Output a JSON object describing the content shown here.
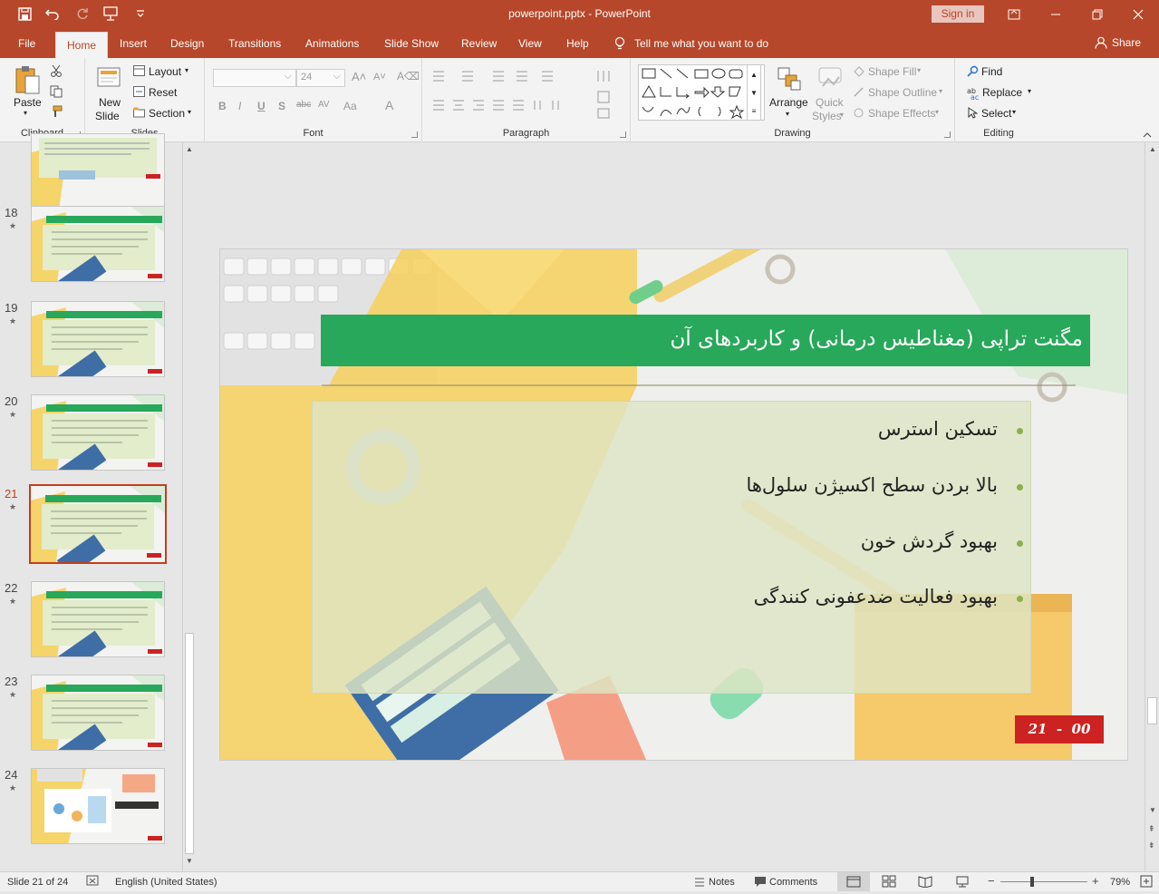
{
  "window": {
    "title": "powerpoint.pptx  -  PowerPoint",
    "sign_in": "Sign in"
  },
  "tabs": [
    {
      "label": "File"
    },
    {
      "label": "Home"
    },
    {
      "label": "Insert"
    },
    {
      "label": "Design"
    },
    {
      "label": "Transitions"
    },
    {
      "label": "Animations"
    },
    {
      "label": "Slide Show"
    },
    {
      "label": "Review"
    },
    {
      "label": "View"
    },
    {
      "label": "Help"
    }
  ],
  "tell_me": "Tell me what you want to do",
  "share": "Share",
  "ribbon": {
    "clipboard": {
      "label": "Clipboard",
      "paste": "Paste"
    },
    "slides": {
      "label": "Slides",
      "new_slide_1": "New",
      "new_slide_2": "Slide",
      "layout": "Layout",
      "reset": "Reset",
      "section": "Section"
    },
    "font": {
      "label": "Font",
      "size": "24"
    },
    "paragraph": {
      "label": "Paragraph"
    },
    "drawing": {
      "label": "Drawing",
      "arrange": "Arrange",
      "quick_styles_1": "Quick",
      "quick_styles_2": "Styles",
      "shape_fill": "Shape Fill",
      "shape_outline": "Shape Outline",
      "shape_effects": "Shape Effects"
    },
    "editing": {
      "label": "Editing",
      "find": "Find",
      "replace": "Replace",
      "select": "Select"
    }
  },
  "thumbnails": [
    {
      "num": "18"
    },
    {
      "num": "19"
    },
    {
      "num": "20"
    },
    {
      "num": "21",
      "selected": true
    },
    {
      "num": "22"
    },
    {
      "num": "23"
    },
    {
      "num": "24"
    }
  ],
  "slide": {
    "title": "مگنت تراپی (مغناطیس درمانی) و کاربردهای آن",
    "bullets": [
      "تسکین استرس",
      "بالا بردن سطح اکسیژن سلول‌ها",
      "بهبود گردش خون",
      "بهبود فعالیت ضدعفونی کنندگی"
    ],
    "page_badge": "21  -  00"
  },
  "status": {
    "slide_info": "Slide 21 of 24",
    "language": "English (United States)",
    "notes": "Notes",
    "comments": "Comments",
    "zoom": "79%"
  },
  "colors": {
    "accent": "#b7472a",
    "title_bar": "#27a85a",
    "badge": "#cc2222",
    "bullet": "#8ab04a",
    "content_box": "#dfe6c8"
  }
}
